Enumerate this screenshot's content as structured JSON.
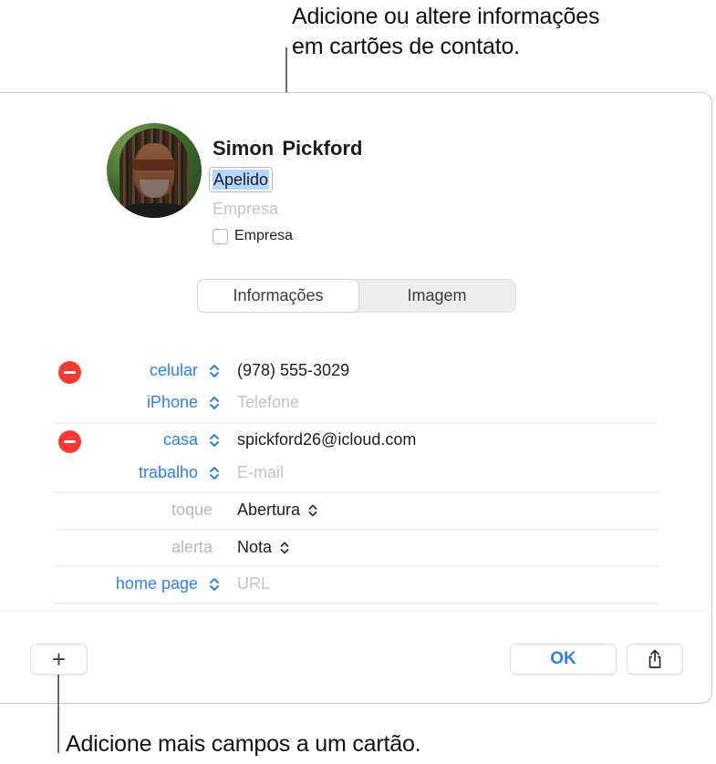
{
  "callouts": {
    "top_line1": "Adicione ou altere informações",
    "top_line2": "em cartões de contato.",
    "bottom": "Adicione mais campos a um cartão."
  },
  "contact": {
    "first_name": "Simon",
    "last_name": "Pickford",
    "nickname_field": "Apelido",
    "company_placeholder": "Empresa",
    "company_checkbox_label": "Empresa",
    "company_checked": false,
    "avatar_icon": "contact-photo"
  },
  "tabs": [
    {
      "label": "Informações",
      "active": true
    },
    {
      "label": "Imagem",
      "active": false
    }
  ],
  "fields": {
    "phone": [
      {
        "label": "celular",
        "value": "(978) 555-3029",
        "placeholder": false,
        "removable": true
      },
      {
        "label": "iPhone",
        "value": "Telefone",
        "placeholder": true,
        "removable": false
      }
    ],
    "email": [
      {
        "label": "casa",
        "value": "spickford26@icloud.com",
        "placeholder": false,
        "removable": true
      },
      {
        "label": "trabalho",
        "value": "E-mail",
        "placeholder": true,
        "removable": false
      }
    ],
    "ringtone": {
      "label": "toque",
      "value": "Abertura"
    },
    "alert": {
      "label": "alerta",
      "value": "Nota"
    },
    "homepage": {
      "label": "home page",
      "value": "URL",
      "placeholder": true
    }
  },
  "footer": {
    "add_icon": "+",
    "ok_label": "OK",
    "share_icon": "share-icon"
  },
  "colors": {
    "accent": "#2f80ed",
    "remove": "#fa3b33",
    "selection": "#b3d7ff",
    "placeholder": "#c4c4c4"
  }
}
